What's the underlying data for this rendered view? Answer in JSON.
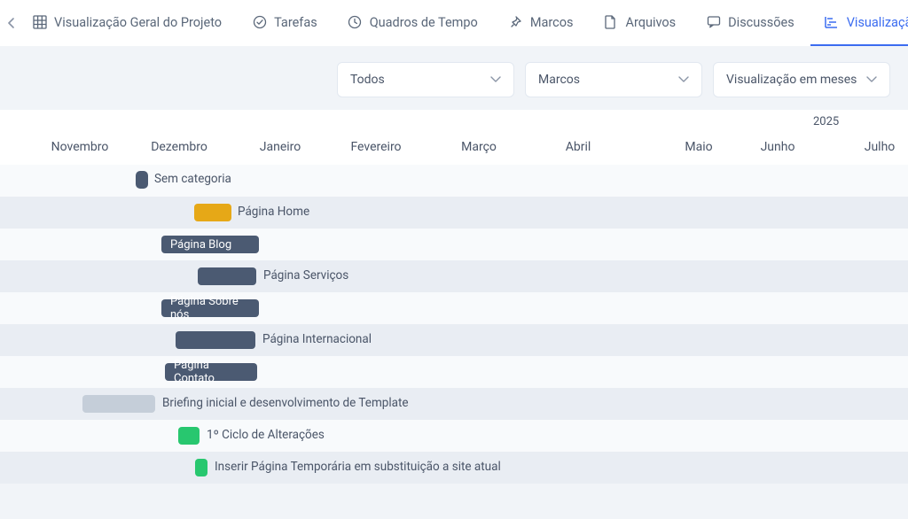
{
  "tabs": {
    "overview": "Visualização Geral do Projeto",
    "tasks": "Tarefas",
    "timeframes": "Quadros de Tempo",
    "milestones": "Marcos",
    "files": "Arquivos",
    "discussions": "Discussões",
    "gantt": "Visualização Gantt"
  },
  "filters": {
    "filter1": "Todos",
    "filter2": "Marcos",
    "filter3": "Visualização em meses"
  },
  "timeline": {
    "year": "2025",
    "months": {
      "m1": "Novembro",
      "m2": "Dezembro",
      "m3": "Janeiro",
      "m4": "Fevereiro",
      "m5": "Março",
      "m6": "Abril",
      "m7": "Maio",
      "m8": "Junho",
      "m9": "Julho"
    }
  },
  "items": {
    "i0": "Sem categoria",
    "i1": "Página Home",
    "i2": "Página Blog",
    "i3": "Página Serviços",
    "i4": "Página Sobre nós",
    "i5": "Página Internacional",
    "i6": "Página Contato",
    "i7": "Briefing inicial e desenvolvimento de Template",
    "i8": "1º Ciclo de Alterações",
    "i9": "Inserir Página Temporária em substituição a site atual"
  }
}
